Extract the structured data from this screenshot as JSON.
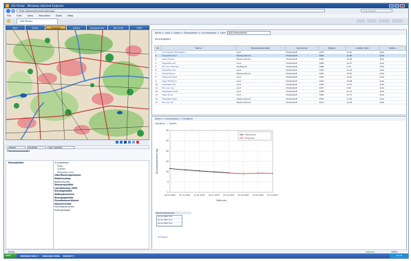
{
  "window": {
    "title": "GIS Portal - Windows Internet Explorer"
  },
  "browser": {
    "url": "http://gisportal.example/app",
    "search_placeholder": "Live Search",
    "menu": [
      "File",
      "Edit",
      "View",
      "Favorites",
      "Tools",
      "Help"
    ],
    "tab_label": "GIS Portal"
  },
  "app_tabs": [
    "Start",
    "Karte",
    "Projekte",
    "Daten",
    "Auswertung",
    "Berichte",
    "Hilfe"
  ],
  "left_panel": {
    "toolbar": [
      "Ebene",
      "Anzeige",
      "Alle Objekte"
    ],
    "caption": "Themenauswahl",
    "tree_root": "Messstellen",
    "tree_items": [
      {
        "label": "Grundwasser",
        "level": 0
      },
      {
        "label": "Pegel",
        "level": 1
      },
      {
        "label": "Quellen",
        "level": 1
      },
      {
        "label": "Messnetz Land",
        "level": 1
      },
      {
        "label": "Oberflächengewässer",
        "level": 0,
        "bold": true
      },
      {
        "label": "Niederschlag",
        "level": 0,
        "bold": true
      },
      {
        "label": "Bodenfeuchte",
        "level": 0
      },
      {
        "label": "Wasserqualität",
        "level": 0,
        "bold": true
      },
      {
        "label": "Landnutzung 2005",
        "level": 0,
        "bold": true
      },
      {
        "label": "Schutzgebiete",
        "level": 0,
        "bold": true
      },
      {
        "label": "Abflussbereiche",
        "level": 0,
        "bold": true
      },
      {
        "label": "Einzugsgebiete",
        "level": 0,
        "bold": true
      },
      {
        "label": "Grundwasserkörper",
        "level": 0,
        "bold": true
      },
      {
        "label": "Wasserrechte",
        "level": 0,
        "bold": true
      },
      {
        "label": "Hochwasserzonen",
        "level": 0
      },
      {
        "label": "Hydrogeologie",
        "level": 0
      }
    ]
  },
  "records": {
    "breadcrumb": "Karte > Land > Daten > Messstellen > Grundwasser > Liste",
    "select_label": "Alle Messstellen",
    "section_title": "Suchergebnis",
    "columns": [
      "Nr.",
      "Name",
      "Messnetzbetreiber",
      "Gemeinde",
      "Beginn",
      "Letzter Wert",
      "Status"
    ],
    "rows": [
      [
        "1",
        "Grundwasser Messstelle 1",
        "Land",
        "Musterstadt",
        "1978",
        "12,40",
        "aktiv"
      ],
      [
        "2",
        "Messstelle Nord",
        "Wasserverband",
        "Musterstadt",
        "1981",
        "11,85",
        "aktiv"
      ],
      [
        "3",
        "Pegel Flussau",
        "Wasserverband",
        "Musterstadt",
        "1984",
        "10,92",
        "aktiv"
      ],
      [
        "4",
        "Messstelle Ost",
        "Land",
        "Musterstadt",
        "1986",
        "12,07",
        "aktiv"
      ],
      [
        "5",
        "Brunnen Feldmark",
        "Stadtwerke",
        "Musterstadt",
        "1988",
        "9,74",
        "aktiv"
      ],
      [
        "6",
        "Messstelle Süd",
        "Land",
        "Musterstadt",
        "1990",
        "11,32",
        "aktiv"
      ],
      [
        "7",
        "Quelle Bergau",
        "Wasserverband",
        "Musterstadt",
        "1991",
        "10,55",
        "aktiv"
      ],
      [
        "8",
        "Messstelle West",
        "Land",
        "Musterstadt",
        "1993",
        "12,61",
        "aktiv"
      ],
      [
        "9",
        "Pegel Mühlbach",
        "Land",
        "Musterstadt",
        "1994",
        "10,08",
        "aktiv"
      ],
      [
        "10",
        "Messstelle Hof",
        "Land",
        "Musterstadt",
        "1995",
        "11,47",
        "aktiv"
      ],
      [
        "11",
        "Brunnen Aue",
        "Land",
        "Musterstadt",
        "1997",
        "9,96",
        "aktiv"
      ],
      [
        "12",
        "Messstelle Heide",
        "Land",
        "Musterstadt",
        "1998",
        "12,19",
        "aktiv"
      ],
      [
        "13",
        "Pegel Kanal",
        "Land",
        "Musterstadt",
        "1999",
        "10,73",
        "aktiv"
      ],
      [
        "14",
        "Messstelle Wald",
        "Wasserverband",
        "Musterstadt",
        "2000",
        "11,02",
        "aktiv"
      ],
      [
        "15",
        "Brunnen Tal",
        "Wasserverband",
        "Musterstadt",
        "2001",
        "10,38",
        "aktiv"
      ]
    ],
    "highlight_row": 1
  },
  "chart_panel": {
    "breadcrumb": "Daten > Grundwasser > Ganglinie",
    "subtitle": "Ganglinie — Tabelle",
    "table_title": "Tabelle Messwerte",
    "table_rows": [
      "01.01.2004  10,5",
      "01.01.2005  10,2",
      "01.01.2006  10,4"
    ],
    "close_label": "Schließen"
  },
  "chart_data": {
    "type": "line",
    "title": "",
    "xlabel": "Zeitraum",
    "ylabel": "Grundwasserstand [m]",
    "x": [
      "01.01.2000",
      "01.01.2001",
      "01.01.2002",
      "01.01.2003",
      "01.01.2004",
      "01.01.2005",
      "01.01.2006",
      "01.01.2007"
    ],
    "ylim": [
      0,
      30
    ],
    "yticks": [
      0,
      5,
      10,
      15,
      20,
      25,
      30
    ],
    "series": [
      {
        "name": "Messwerte",
        "color": "#222222",
        "values": [
          11.5,
          10.9,
          10.4,
          9.9,
          9.4,
          null,
          null,
          null
        ]
      },
      {
        "name": "Prognose",
        "color": "#d03030",
        "values": [
          null,
          null,
          null,
          null,
          9.4,
          9.0,
          9.3,
          9.2
        ]
      }
    ],
    "legend_position": "top-right",
    "grid": true
  },
  "status": {
    "text": "Fertig",
    "zone": "Internet",
    "zoom": "100%"
  },
  "taskbar": {
    "start": "start",
    "items": [
      "GIS Portal - Win...",
      "Dokument - Editor",
      "Explorer"
    ],
    "clock": "12:34"
  }
}
